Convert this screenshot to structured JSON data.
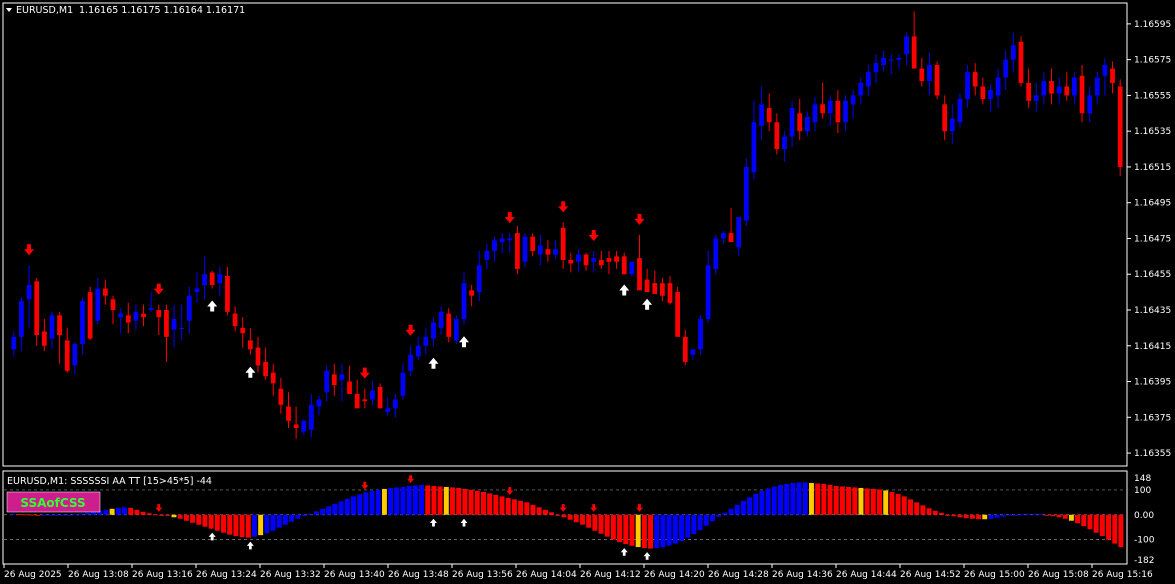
{
  "header": {
    "symbol": "EURUSD,M1",
    "ohlc": "1.16165 1.16175 1.16164 1.16171"
  },
  "indicator": {
    "title": "EURUSD,M1: SSSSSSI AA TT [15>45*5] -44",
    "badge": "SSAofCSS",
    "scale_labels": [
      "148",
      "100",
      "0.00",
      "-100",
      "-182"
    ]
  },
  "price_axis": {
    "labels": [
      "1.16595",
      "1.16575",
      "1.16555",
      "1.16535",
      "1.16515",
      "1.16495",
      "1.16475",
      "1.16455",
      "1.16435",
      "1.16415",
      "1.16395",
      "1.16375",
      "1.16355"
    ]
  },
  "time_axis": {
    "labels": [
      "26 Aug 2025",
      "26 Aug 13:08",
      "26 Aug 13:16",
      "26 Aug 13:24",
      "26 Aug 13:32",
      "26 Aug 13:40",
      "26 Aug 13:48",
      "26 Aug 13:56",
      "26 Aug 14:04",
      "26 Aug 14:12",
      "26 Aug 14:20",
      "26 Aug 14:28",
      "26 Aug 14:36",
      "26 Aug 14:44",
      "26 Aug 14:52",
      "26 Aug 15:00",
      "26 Aug 15:08",
      "26 Aug 15:16"
    ]
  },
  "colors": {
    "background": "#000000",
    "bull": "#0000ff",
    "bear": "#ff0000",
    "signal_up": "#ffffff",
    "signal_down": "#ff0000",
    "hist_highlight": "#ffcc00",
    "badge_bg": "#cc1e8c",
    "badge_text": "#33ff33"
  },
  "chart_data": [
    {
      "type": "candlestick",
      "symbol": "EURUSD,M1",
      "ylim": [
        1.1635,
        1.16605
      ],
      "candles": [
        [
          1.16413,
          1.16423,
          1.16409,
          1.1642
        ],
        [
          1.1642,
          1.16442,
          1.16412,
          1.1644
        ],
        [
          1.16441,
          1.1646,
          1.16425,
          1.16449
        ],
        [
          1.16451,
          1.16453,
          1.16415,
          1.16421
        ],
        [
          1.16423,
          1.1643,
          1.16412,
          1.16415
        ],
        [
          1.16419,
          1.16434,
          1.16413,
          1.16432
        ],
        [
          1.16432,
          1.16434,
          1.16405,
          1.16421
        ],
        [
          1.16418,
          1.16425,
          1.164,
          1.16401
        ],
        [
          1.16404,
          1.16417,
          1.16399,
          1.16416
        ],
        [
          1.16416,
          1.16442,
          1.1641,
          1.1644
        ],
        [
          1.16445,
          1.16448,
          1.16418,
          1.16419
        ],
        [
          1.16429,
          1.16453,
          1.16427,
          1.16447
        ],
        [
          1.16447,
          1.16452,
          1.16438,
          1.16443
        ],
        [
          1.16441,
          1.16443,
          1.16427,
          1.16435
        ],
        [
          1.16431,
          1.16436,
          1.16422,
          1.16433
        ],
        [
          1.16432,
          1.16439,
          1.16422,
          1.16428
        ],
        [
          1.16429,
          1.16438,
          1.16424,
          1.16434
        ],
        [
          1.16433,
          1.16438,
          1.16426,
          1.16431
        ],
        [
          1.16435,
          1.16445,
          1.16434,
          1.16436
        ],
        [
          1.16435,
          1.16438,
          1.16421,
          1.16431
        ],
        [
          1.16435,
          1.16438,
          1.16406,
          1.1642
        ],
        [
          1.16424,
          1.16438,
          1.16414,
          1.1643
        ],
        [
          1.16425,
          1.16438,
          1.16418,
          1.16425
        ],
        [
          1.16429,
          1.16448,
          1.16422,
          1.16443
        ],
        [
          1.16445,
          1.16456,
          1.16439,
          1.16447
        ],
        [
          1.16449,
          1.16465,
          1.16441,
          1.16455
        ],
        [
          1.16456,
          1.16457,
          1.16447,
          1.16449
        ],
        [
          1.1645,
          1.16459,
          1.16443,
          1.16455
        ],
        [
          1.16454,
          1.16459,
          1.16432,
          1.16434
        ],
        [
          1.16433,
          1.16437,
          1.16423,
          1.16426
        ],
        [
          1.16425,
          1.16431,
          1.16414,
          1.16422
        ],
        [
          1.16418,
          1.16425,
          1.1641,
          1.16413
        ],
        [
          1.16414,
          1.1642,
          1.164,
          1.16404
        ],
        [
          1.16406,
          1.16414,
          1.16396,
          1.16398
        ],
        [
          1.164,
          1.16405,
          1.16387,
          1.16394
        ],
        [
          1.16391,
          1.16397,
          1.16377,
          1.16382
        ],
        [
          1.16381,
          1.16389,
          1.16369,
          1.16373
        ],
        [
          1.16371,
          1.16381,
          1.16363,
          1.16369
        ],
        [
          1.16367,
          1.16374,
          1.16365,
          1.16373
        ],
        [
          1.16368,
          1.16388,
          1.16364,
          1.16382
        ],
        [
          1.16381,
          1.16387,
          1.16376,
          1.16385
        ],
        [
          1.16389,
          1.16404,
          1.16384,
          1.16401
        ],
        [
          1.16399,
          1.16405,
          1.16387,
          1.16393
        ],
        [
          1.16396,
          1.16405,
          1.16384,
          1.16399
        ],
        [
          1.16395,
          1.16404,
          1.16391,
          1.16388
        ],
        [
          1.16388,
          1.16396,
          1.16383,
          1.1638
        ],
        [
          1.16385,
          1.16391,
          1.1638,
          1.16384
        ],
        [
          1.16385,
          1.16395,
          1.16382,
          1.1639
        ],
        [
          1.16392,
          1.16394,
          1.1638,
          1.1638
        ],
        [
          1.16378,
          1.16386,
          1.16376,
          1.1638
        ],
        [
          1.1638,
          1.16388,
          1.16375,
          1.16385
        ],
        [
          1.16387,
          1.16405,
          1.16385,
          1.164
        ],
        [
          1.16401,
          1.16415,
          1.16398,
          1.1641
        ],
        [
          1.16409,
          1.1642,
          1.16407,
          1.16415
        ],
        [
          1.16415,
          1.16425,
          1.1641,
          1.1642
        ],
        [
          1.16419,
          1.16431,
          1.16415,
          1.16428
        ],
        [
          1.16425,
          1.16437,
          1.16421,
          1.16434
        ],
        [
          1.16433,
          1.16436,
          1.16417,
          1.1642
        ],
        [
          1.16418,
          1.16432,
          1.16416,
          1.1643
        ],
        [
          1.1643,
          1.16456,
          1.16427,
          1.1645
        ],
        [
          1.16446,
          1.16449,
          1.16437,
          1.16443
        ],
        [
          1.16445,
          1.16468,
          1.1644,
          1.1646
        ],
        [
          1.16463,
          1.16472,
          1.16458,
          1.16468
        ],
        [
          1.16468,
          1.16476,
          1.16462,
          1.16474
        ],
        [
          1.16473,
          1.16478,
          1.16467,
          1.16475
        ],
        [
          1.16474,
          1.16478,
          1.16467,
          1.16475
        ],
        [
          1.16478,
          1.16482,
          1.16455,
          1.16458
        ],
        [
          1.16462,
          1.16478,
          1.16459,
          1.16476
        ],
        [
          1.16476,
          1.16478,
          1.16465,
          1.16468
        ],
        [
          1.16466,
          1.16477,
          1.1646,
          1.16471
        ],
        [
          1.16469,
          1.16474,
          1.16462,
          1.16466
        ],
        [
          1.16466,
          1.16474,
          1.16464,
          1.16469
        ],
        [
          1.16481,
          1.16484,
          1.16458,
          1.16463
        ],
        [
          1.16463,
          1.16467,
          1.16456,
          1.16461
        ],
        [
          1.16462,
          1.16469,
          1.16456,
          1.16466
        ],
        [
          1.16466,
          1.16467,
          1.16457,
          1.1646
        ],
        [
          1.16462,
          1.16468,
          1.16456,
          1.16464
        ],
        [
          1.16463,
          1.16468,
          1.16458,
          1.1646
        ],
        [
          1.16464,
          1.16468,
          1.16455,
          1.16462
        ],
        [
          1.16465,
          1.16468,
          1.16458,
          1.16462
        ],
        [
          1.16465,
          1.16467,
          1.16456,
          1.16455
        ],
        [
          1.16455,
          1.16462,
          1.16454,
          1.16462
        ],
        [
          1.16464,
          1.16477,
          1.1646,
          1.16446
        ],
        [
          1.16452,
          1.16458,
          1.16448,
          1.16445
        ],
        [
          1.1645,
          1.16457,
          1.16446,
          1.16444
        ],
        [
          1.1645,
          1.16453,
          1.1644,
          1.16443
        ],
        [
          1.1645,
          1.16454,
          1.16438,
          1.16439
        ],
        [
          1.16445,
          1.16448,
          1.16425,
          1.1642
        ],
        [
          1.1642,
          1.16424,
          1.16404,
          1.16406
        ],
        [
          1.1641,
          1.16413,
          1.16407,
          1.16413
        ],
        [
          1.16413,
          1.16432,
          1.1641,
          1.1643
        ],
        [
          1.1643,
          1.16468,
          1.16428,
          1.1646
        ],
        [
          1.16458,
          1.16477,
          1.16455,
          1.16475
        ],
        [
          1.16475,
          1.16479,
          1.16472,
          1.16478
        ],
        [
          1.16478,
          1.16492,
          1.16474,
          1.16473
        ],
        [
          1.1647,
          1.16483,
          1.16465,
          1.16487
        ],
        [
          1.16485,
          1.1652,
          1.16482,
          1.16515
        ],
        [
          1.16512,
          1.16552,
          1.16508,
          1.1654
        ],
        [
          1.16538,
          1.1656,
          1.1653,
          1.1655
        ],
        [
          1.16548,
          1.16556,
          1.16535,
          1.1654
        ],
        [
          1.1654,
          1.16545,
          1.16522,
          1.16525
        ],
        [
          1.16525,
          1.16535,
          1.16518,
          1.16532
        ],
        [
          1.16532,
          1.16552,
          1.16526,
          1.16548
        ],
        [
          1.16545,
          1.16553,
          1.1653,
          1.16535
        ],
        [
          1.16535,
          1.16546,
          1.16532,
          1.16543
        ],
        [
          1.1654,
          1.16554,
          1.16535,
          1.1655
        ],
        [
          1.1655,
          1.16562,
          1.16542,
          1.16545
        ],
        [
          1.16545,
          1.16555,
          1.16538,
          1.16552
        ],
        [
          1.16552,
          1.16558,
          1.16534,
          1.1654
        ],
        [
          1.1654,
          1.16555,
          1.16535,
          1.16552
        ],
        [
          1.1655,
          1.16558,
          1.16542,
          1.16555
        ],
        [
          1.16555,
          1.16565,
          1.1655,
          1.16562
        ],
        [
          1.1656,
          1.16572,
          1.16555,
          1.16568
        ],
        [
          1.16568,
          1.16578,
          1.16562,
          1.16573
        ],
        [
          1.16572,
          1.1658,
          1.16568,
          1.16576
        ],
        [
          1.16575,
          1.16578,
          1.16567,
          1.16575
        ],
        [
          1.16575,
          1.16578,
          1.1657,
          1.16576
        ],
        [
          1.16578,
          1.1659,
          1.16572,
          1.16588
        ],
        [
          1.16588,
          1.16602,
          1.1658,
          1.1657
        ],
        [
          1.1657,
          1.16576,
          1.1656,
          1.16563
        ],
        [
          1.16563,
          1.16579,
          1.16555,
          1.16572
        ],
        [
          1.16572,
          1.16574,
          1.16553,
          1.16555
        ],
        [
          1.1655,
          1.16555,
          1.1653,
          1.16535
        ],
        [
          1.16535,
          1.1655,
          1.16528,
          1.16542
        ],
        [
          1.1654,
          1.16556,
          1.16537,
          1.16553
        ],
        [
          1.16553,
          1.16572,
          1.16548,
          1.16568
        ],
        [
          1.16568,
          1.16573,
          1.16555,
          1.1656
        ],
        [
          1.1656,
          1.16565,
          1.1655,
          1.16553
        ],
        [
          1.16553,
          1.16561,
          1.16546,
          1.16558
        ],
        [
          1.16555,
          1.1657,
          1.16548,
          1.16565
        ],
        [
          1.16565,
          1.1658,
          1.16558,
          1.16575
        ],
        [
          1.16575,
          1.1659,
          1.16568,
          1.16583
        ],
        [
          1.16585,
          1.16588,
          1.1656,
          1.16562
        ],
        [
          1.16562,
          1.1657,
          1.16548,
          1.16552
        ],
        [
          1.16552,
          1.16562,
          1.16546,
          1.16555
        ],
        [
          1.16555,
          1.16568,
          1.1655,
          1.16563
        ],
        [
          1.16563,
          1.1657,
          1.1655,
          1.16556
        ],
        [
          1.16556,
          1.16565,
          1.1655,
          1.1656
        ],
        [
          1.1656,
          1.16568,
          1.16552,
          1.16555
        ],
        [
          1.16555,
          1.16568,
          1.1655,
          1.16565
        ],
        [
          1.16566,
          1.16572,
          1.1654,
          1.16545
        ],
        [
          1.16545,
          1.1656,
          1.1654,
          1.16555
        ],
        [
          1.16555,
          1.16568,
          1.1655,
          1.16565
        ],
        [
          1.16566,
          1.16576,
          1.16555,
          1.16572
        ],
        [
          1.1657,
          1.16574,
          1.16556,
          1.16562
        ],
        [
          1.1656,
          1.16564,
          1.1651,
          1.16515
        ]
      ],
      "signals_up": [
        26,
        31,
        55,
        59,
        80,
        83
      ],
      "signals_down": [
        2,
        19,
        46,
        52,
        65,
        72,
        76,
        82
      ]
    },
    {
      "type": "bar",
      "title": "EURUSD,M1: SSSSSSI AA TT [15>45*5] -44",
      "ylim": [
        -182,
        148
      ],
      "levels": [
        100,
        0,
        -100
      ],
      "values": [
        4,
        3,
        2,
        1,
        0,
        0,
        0,
        0,
        0,
        0,
        2,
        5,
        8,
        12,
        16,
        20,
        24,
        28,
        30,
        28,
        20,
        12,
        6,
        2,
        0,
        -4,
        -10,
        -16,
        -24,
        -32,
        -40,
        -48,
        -56,
        -64,
        -72,
        -80,
        -86,
        -90,
        -92,
        -88,
        -82,
        -74,
        -64,
        -52,
        -40,
        -28,
        -16,
        -6,
        4,
        14,
        24,
        34,
        44,
        54,
        64,
        74,
        82,
        90,
        96,
        100,
        104,
        108,
        110,
        112,
        116,
        118,
        120,
        118,
        116,
        114,
        112,
        110,
        108,
        104,
        100,
        96,
        92,
        86,
        80,
        74,
        68,
        62,
        56,
        50,
        40,
        30,
        20,
        10,
        0,
        -10,
        -20,
        -30,
        -40,
        -52,
        -64,
        -76,
        -88,
        -100,
        -110,
        -118,
        -125,
        -130,
        -134,
        -136,
        -134,
        -130,
        -124,
        -116,
        -106,
        -92,
        -78,
        -62,
        -44,
        -26,
        -8,
        8,
        24,
        40,
        56,
        70,
        84,
        96,
        106,
        114,
        120,
        124,
        128,
        130,
        130,
        128,
        126,
        124,
        120,
        116,
        114,
        112,
        110,
        108,
        106,
        104,
        102,
        98,
        92,
        84,
        74,
        62,
        50,
        38,
        26,
        16,
        8,
        0,
        -6,
        -10,
        -14,
        -16,
        -18,
        -18,
        -16,
        -12,
        -8,
        -4,
        0,
        2,
        4,
        4,
        4,
        0,
        -6,
        -10,
        -16,
        -24,
        -34,
        -46,
        -58,
        -72,
        -86,
        -100,
        -116,
        -130
      ],
      "highlight_bars": [
        16,
        26,
        40,
        60,
        70,
        101,
        129,
        137,
        141,
        157,
        171
      ]
    }
  ]
}
